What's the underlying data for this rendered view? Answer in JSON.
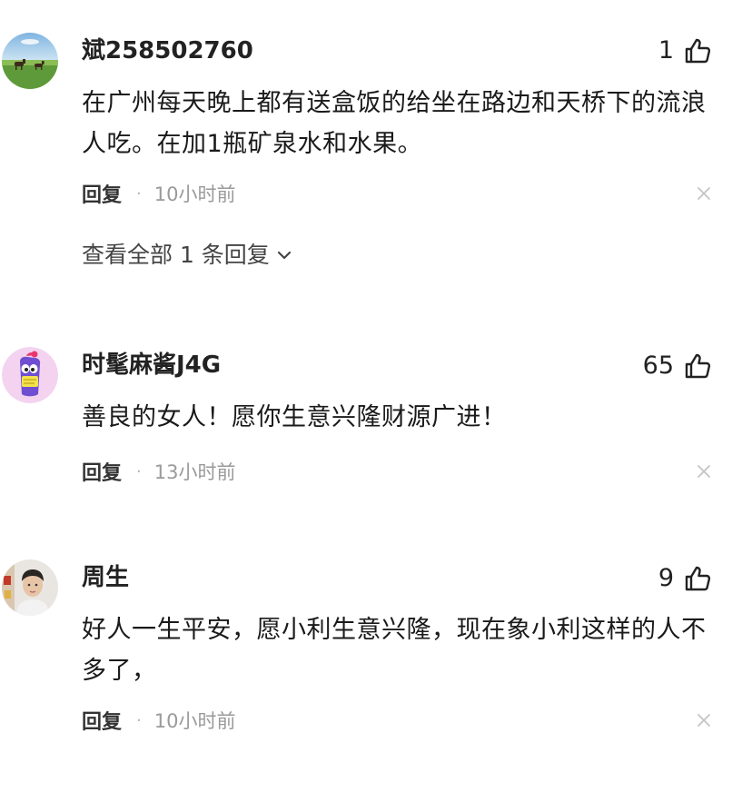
{
  "comments": [
    {
      "username": "斌258502760",
      "likes": "1",
      "text": "在广州每天晚上都有送盒饭的给坐在路边和天桥下的流浪人吃。在加1瓶矿泉水和水果。",
      "reply_label": "回复",
      "separator": "·",
      "time": "10小时前",
      "view_replies": "查看全部 1 条回复",
      "avatar_icon": "landscape-horses-avatar"
    },
    {
      "username": "时髦麻酱J4G",
      "likes": "65",
      "text": "善良的女人！愿你生意兴隆财源广进！",
      "reply_label": "回复",
      "separator": "·",
      "time": "13小时前",
      "avatar_icon": "purple-cartoon-avatar"
    },
    {
      "username": "周生",
      "likes": "9",
      "text": "好人一生平安，愿小利生意兴隆，现在象小利这样的人不多了，",
      "reply_label": "回复",
      "separator": "·",
      "time": "10小时前",
      "avatar_icon": "person-photo-avatar"
    }
  ],
  "icons": {
    "like": "thumbs-up-outline-icon",
    "close": "close-x-icon",
    "expand": "chevron-down-icon"
  },
  "colors": {
    "text": "#1a1a1a",
    "meta": "#9a9a9a",
    "close": "#c4c4c4"
  }
}
